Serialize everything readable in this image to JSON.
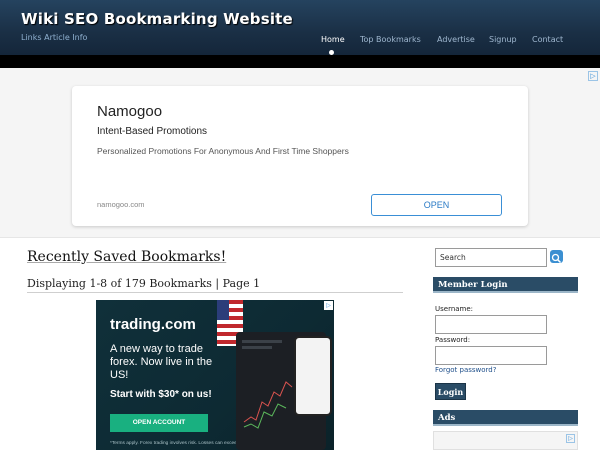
{
  "header": {
    "site_title": "Wiki SEO Bookmarking Website",
    "tagline": "Links Article Info",
    "nav": [
      "Home",
      "Top Bookmarks",
      "Advertise",
      "Signup",
      "Contact"
    ],
    "active_nav": "Home"
  },
  "top_ad": {
    "brand": "Namogoo",
    "headline": "Intent-Based Promotions",
    "description": "Personalized Promotions For Anonymous And First Time Shoppers",
    "domain": "namogoo.com",
    "cta": "OPEN",
    "corner_icon": "adchoices-icon"
  },
  "main": {
    "heading": "Recently Saved Bookmarks!",
    "displaying": "Displaying 1-8 of 179 Bookmarks | Page 1"
  },
  "trade_ad": {
    "logo": "trading.com",
    "copy": "A new way to trade forex. Now live in the US!",
    "offer": "Start with $30* on us!",
    "cta": "OPEN ACCOUNT",
    "terms": "*Terms apply. Forex trading involves risk. Losses can exceed deposits."
  },
  "sidebar": {
    "search_placeholder": "Search",
    "member_login_title": "Member Login",
    "username_label": "Username:",
    "password_label": "Password:",
    "forgot_link": "Forgot password?",
    "login_button": "Login",
    "ads_title": "Ads"
  },
  "colors": {
    "header_bg": "#1a2f45",
    "sidebar_header_bg": "#2a4c66",
    "accent_blue": "#3a8fd6",
    "trade_green": "#19b080"
  }
}
